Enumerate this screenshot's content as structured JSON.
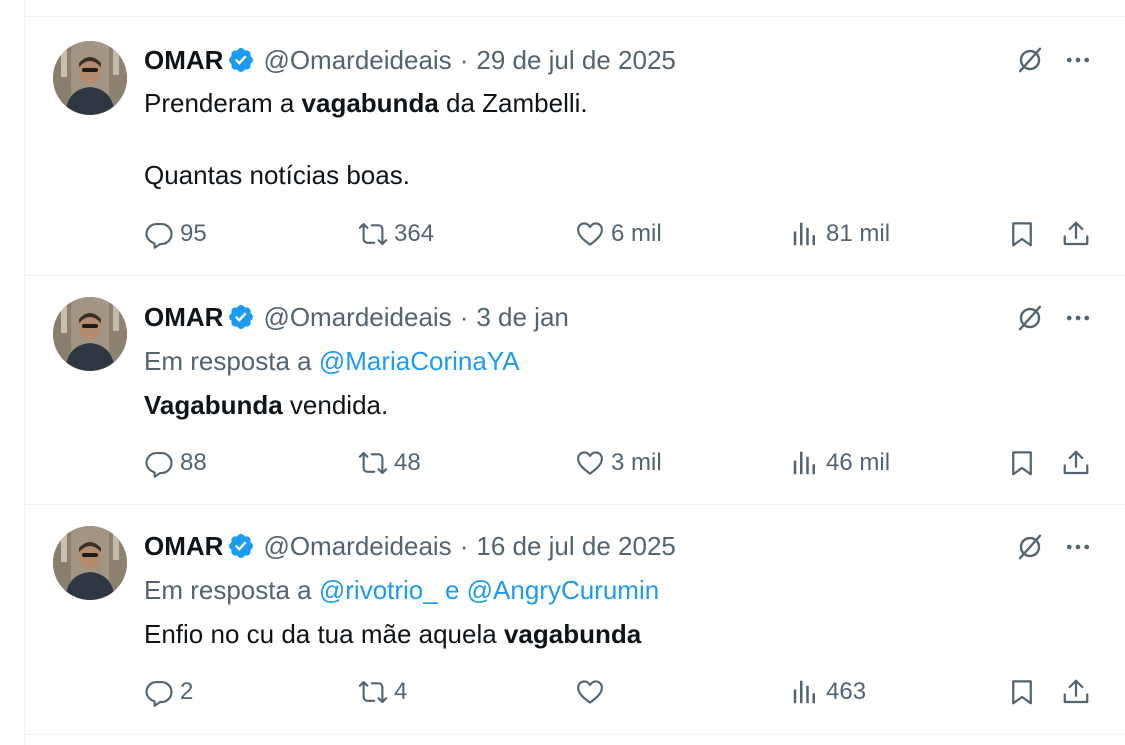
{
  "tweets": [
    {
      "name": "OMAR",
      "handle": "@Omardeideais",
      "separator": "·",
      "date": "29 de jul de 2025",
      "reply_prefix": "",
      "reply_mentions": "",
      "line1_before": "Prenderam a ",
      "line1_bold": "vagabunda",
      "line1_after": " da Zambelli.",
      "line2": "Quantas notícias boas.",
      "replies": "95",
      "retweets": "364",
      "likes": "6 mil",
      "views": "81 mil"
    },
    {
      "name": "OMAR",
      "handle": "@Omardeideais",
      "separator": "·",
      "date": "3 de jan",
      "reply_prefix": "Em resposta a ",
      "reply_mentions": "@MariaCorinaYA",
      "line1_before": "",
      "line1_bold": "Vagabunda",
      "line1_after": " vendida.",
      "line2": "",
      "replies": "88",
      "retweets": "48",
      "likes": "3 mil",
      "views": "46 mil"
    },
    {
      "name": "OMAR",
      "handle": "@Omardeideais",
      "separator": "·",
      "date": "16 de jul de 2025",
      "reply_prefix": "Em resposta a ",
      "reply_mentions": "@rivotrio_ e @AngryCurumin",
      "line1_before": "Enfio no cu da tua mãe aquela ",
      "line1_bold": "vagabunda",
      "line1_after": "",
      "line2": "",
      "replies": "2",
      "retweets": "4",
      "likes": "",
      "views": "463"
    }
  ],
  "icons": {
    "verified": "verified-badge-icon",
    "grok": "grok-icon",
    "more": "more-icon",
    "reply": "reply-icon",
    "retweet": "retweet-icon",
    "like": "like-icon",
    "views": "views-icon",
    "bookmark": "bookmark-icon",
    "share": "share-icon"
  },
  "colors": {
    "text": "#0f1419",
    "secondary": "#536471",
    "accent": "#1d9bf0",
    "border": "#eff3f4"
  }
}
